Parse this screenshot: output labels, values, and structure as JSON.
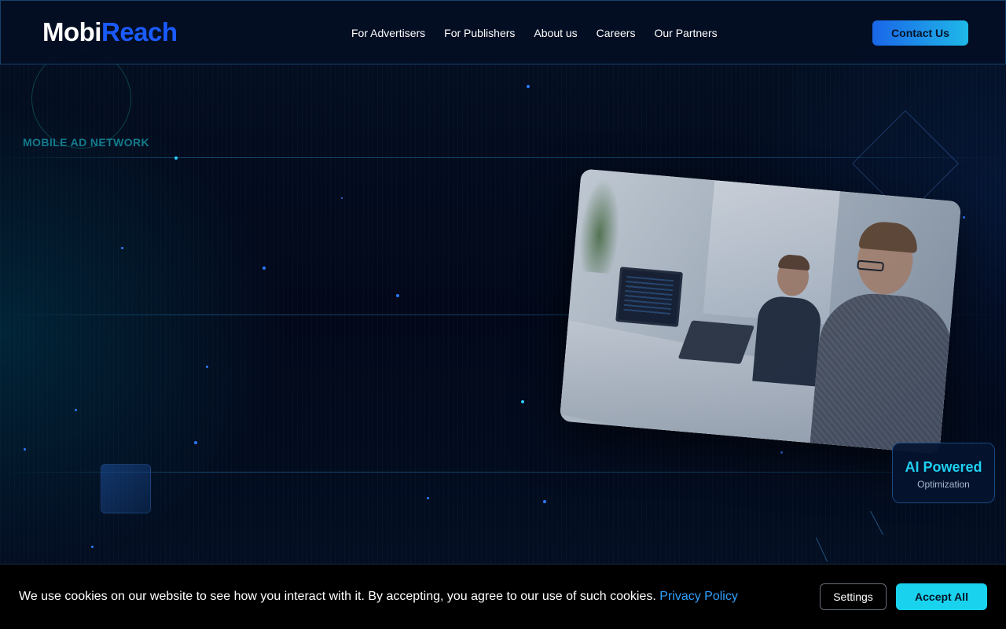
{
  "brand": {
    "logo_part1": "Mobi",
    "logo_part2": "Reach"
  },
  "nav": {
    "items": [
      {
        "label": "For Advertisers"
      },
      {
        "label": "For Publishers"
      },
      {
        "label": "About us"
      },
      {
        "label": "Careers"
      },
      {
        "label": "Our Partners"
      }
    ],
    "contact_label": "Contact Us"
  },
  "hero": {
    "overline": "MOBILE AD NETWORK",
    "badge": {
      "title": "AI Powered",
      "subtitle": "Optimization"
    }
  },
  "cookie": {
    "message": "We use cookies on our website to see how you interact with it. By accepting, you agree to our use of such cookies.",
    "privacy_link": "Privacy Policy",
    "settings_label": "Settings",
    "accept_label": "Accept All"
  },
  "colors": {
    "background": "#020816",
    "brand_blue": "#1a5bff",
    "accent_cyan": "#19d3ee",
    "overline_teal": "#137a8c"
  },
  "icons": [
    "logo-bell-icon"
  ]
}
